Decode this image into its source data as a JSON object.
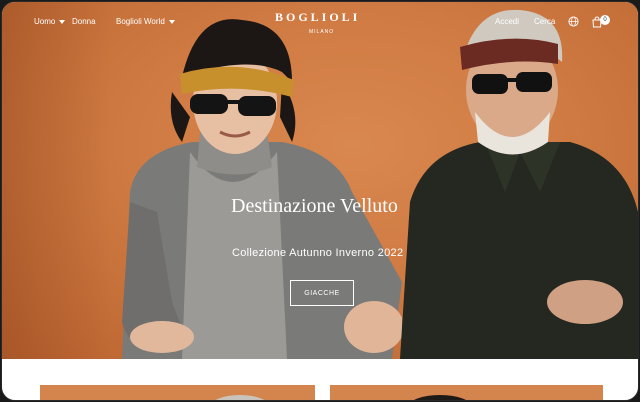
{
  "header": {
    "nav_left": [
      {
        "label": "Uomo",
        "dropdown": true
      },
      {
        "label": "Donna",
        "dropdown": false
      },
      {
        "label": "Boglioli World",
        "dropdown": true
      }
    ],
    "logo": "BOGLIOLI",
    "logo_sub": "MILANO",
    "nav_right": {
      "account_label": "Accedi",
      "search_label": "Cerca",
      "cart_count": "0"
    },
    "icons": [
      "globe-icon",
      "cart-icon"
    ]
  },
  "hero": {
    "title": "Destinazione Velluto",
    "subtitle": "Collezione Autunno Inverno 2022",
    "cta_label": "GIACCHE",
    "background_color": "#cf7a42"
  },
  "colors": {
    "accent": "#cf7a42",
    "text_on_hero": "#ffffff"
  }
}
